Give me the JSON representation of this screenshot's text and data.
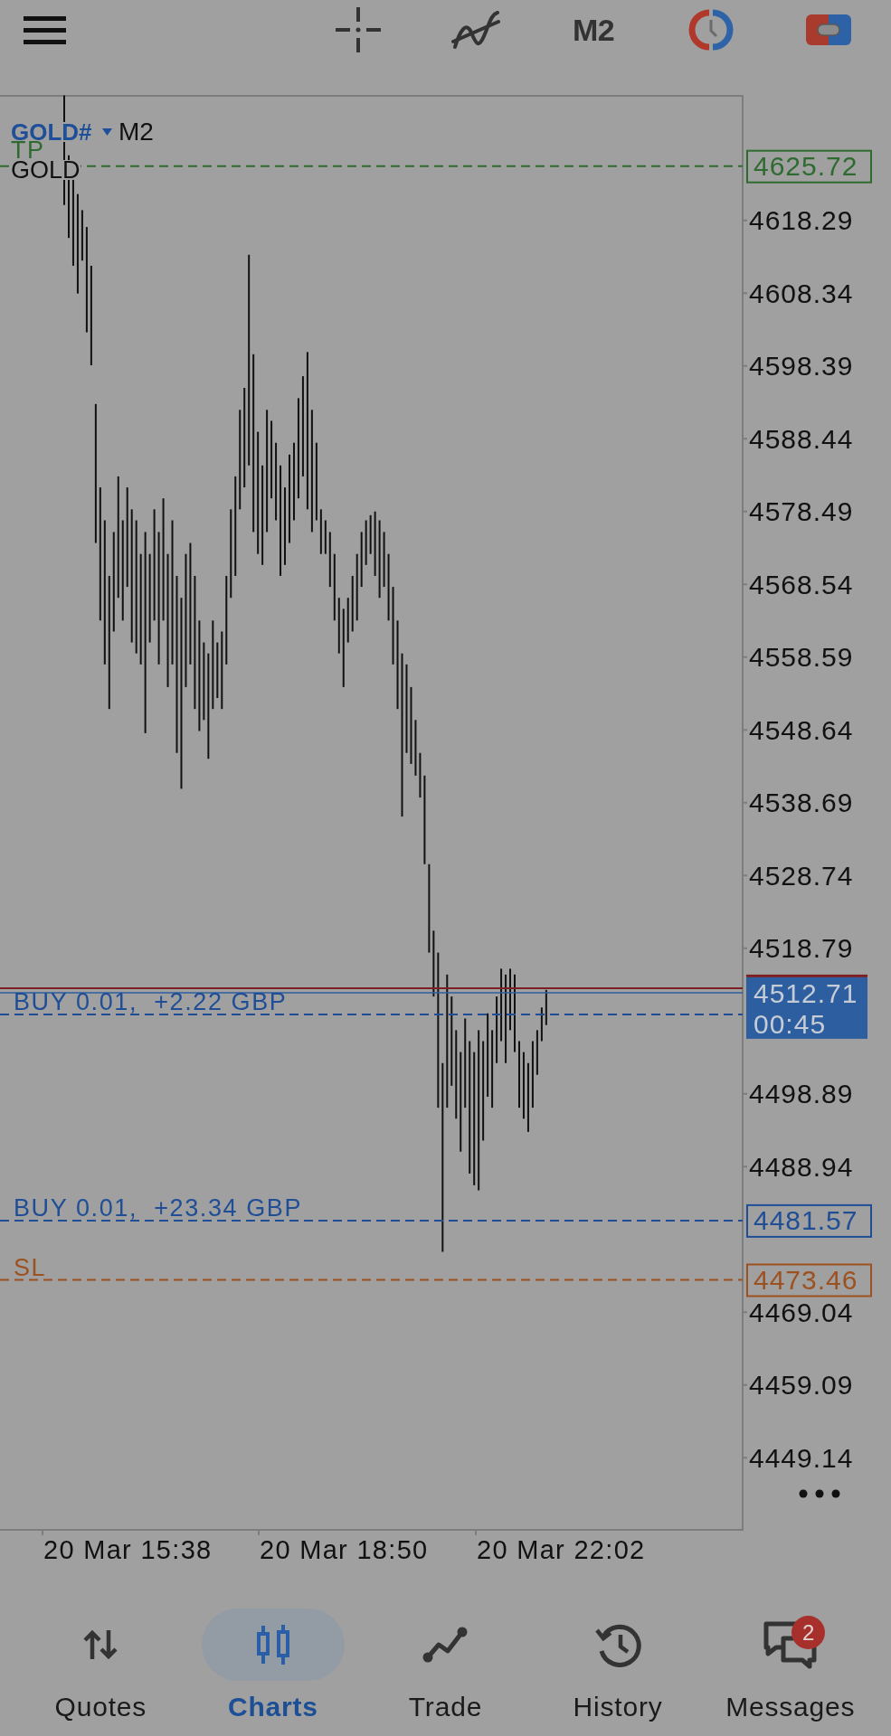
{
  "top_bar": {
    "timeframe": "M2"
  },
  "chart": {
    "symbol": "GOLD#",
    "timeframe": "M2",
    "description": "GOLD",
    "price_axis": [
      "4618.29",
      "4608.34",
      "4598.39",
      "4588.44",
      "4578.49",
      "4568.54",
      "4558.59",
      "4548.64",
      "4538.69",
      "4528.74",
      "4518.79",
      "4498.89",
      "4488.94",
      "4469.04",
      "4459.09",
      "4449.14"
    ],
    "time_axis": [
      "20 Mar 15:38",
      "20 Mar 18:50",
      "20 Mar 22:02"
    ],
    "order_lines": [
      {
        "kind": "tp",
        "label": "TP",
        "tag": "4625.72"
      },
      {
        "kind": "ask"
      },
      {
        "kind": "buy",
        "label": "BUY 0.01,  +2.22 GBP"
      },
      {
        "kind": "bid",
        "tag": "4512.71",
        "timer": "00:45"
      },
      {
        "kind": "buy",
        "label": "BUY 0.01,  +23.34 GBP",
        "tag": "4481.57"
      },
      {
        "kind": "sl",
        "label": "SL",
        "tag": "4473.46"
      }
    ]
  },
  "bottom_nav": {
    "items": [
      {
        "label": "Quotes",
        "selected": false
      },
      {
        "label": "Charts",
        "selected": true
      },
      {
        "label": "Trade",
        "selected": false
      },
      {
        "label": "History",
        "selected": false
      },
      {
        "label": "Messages",
        "selected": false,
        "badge": "2"
      }
    ]
  }
}
